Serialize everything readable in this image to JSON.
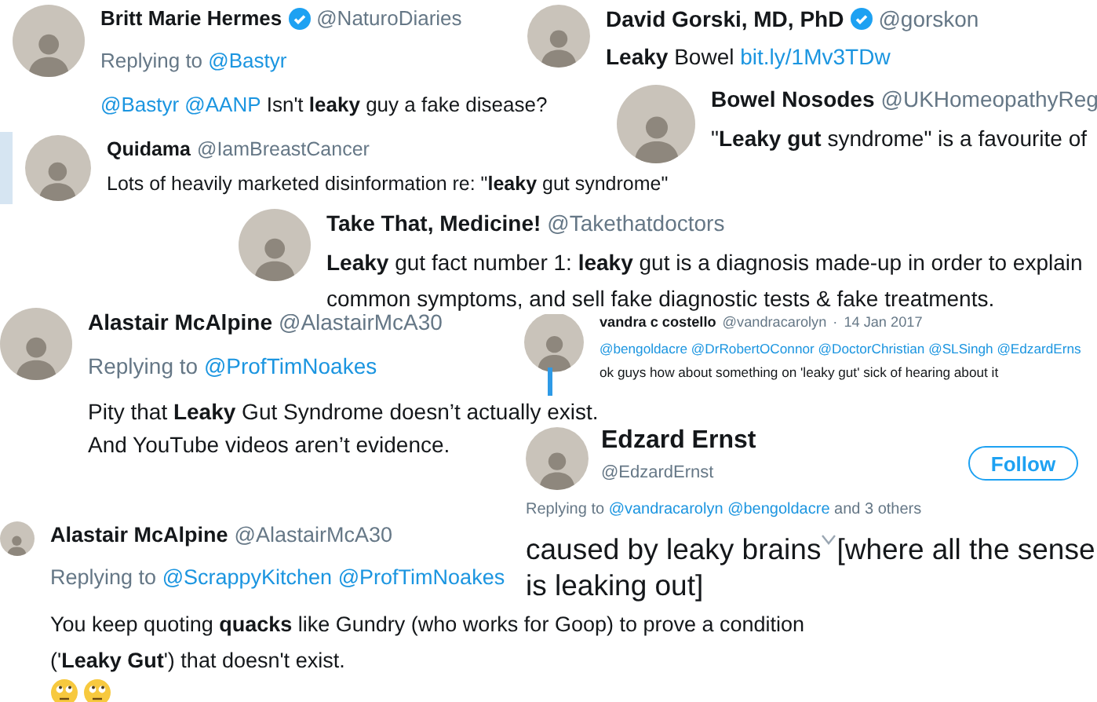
{
  "tweets": [
    {
      "kind": "standard",
      "highlighted": false,
      "name": "Britt Marie Hermes",
      "verified": true,
      "handle": "@NaturoDiaries",
      "replying_to": {
        "label": "Replying to",
        "mentions": [
          "@Bastyr"
        ]
      },
      "lines": [
        [
          {
            "kind": "mention",
            "text": "@Bastyr @AANP"
          },
          {
            "kind": "plain",
            "text": " Isn't **leaky** guy a fake disease?"
          }
        ]
      ]
    },
    {
      "kind": "standard",
      "highlighted": false,
      "name": "David Gorski, MD, PhD",
      "verified": true,
      "handle": "@gorskon",
      "lines": [
        [
          {
            "kind": "plain",
            "text": "**Leaky** Bowel "
          },
          {
            "kind": "link",
            "text": "bit.ly/1Mv3TDw"
          }
        ]
      ]
    },
    {
      "kind": "standard",
      "highlighted": false,
      "name": "Bowel Nosodes",
      "verified": false,
      "handle": "@UKHomeopathyReg",
      "lines": [
        [
          {
            "kind": "plain",
            "text": "\"**Leaky gut** syndrome\" is a favourite of"
          }
        ]
      ]
    },
    {
      "kind": "standard",
      "highlighted": true,
      "name": "Quidama",
      "verified": false,
      "handle": "@IamBreastCancer",
      "lines": [
        [
          {
            "kind": "plain",
            "text": "Lots of heavily marketed disinformation re: \"**leaky** gut syndrome\""
          }
        ]
      ]
    },
    {
      "kind": "standard",
      "highlighted": false,
      "name": "Take That, Medicine!",
      "verified": false,
      "handle": "@Takethatdoctors",
      "lines": [
        [
          {
            "kind": "plain",
            "text": "**Leaky** gut fact number 1: **leaky** gut is a diagnosis made-up in order to explain"
          }
        ],
        [
          {
            "kind": "plain",
            "text": "common symptoms, and sell fake diagnostic tests & fake treatments."
          }
        ]
      ]
    },
    {
      "kind": "standard",
      "highlighted": false,
      "name": "Alastair McAlpine",
      "verified": false,
      "handle": "@AlastairMcA30",
      "replying_to": {
        "label": "Replying to",
        "mentions": [
          "@ProfTimNoakes"
        ]
      },
      "lines": [
        [
          {
            "kind": "plain",
            "text": "Pity that **Leaky** Gut Syndrome doesn’t actually exist."
          }
        ],
        [
          {
            "kind": "plain",
            "text": "And YouTube videos aren’t evidence."
          }
        ]
      ]
    },
    {
      "kind": "compact",
      "highlighted": false,
      "name": "vandra c costello",
      "verified": false,
      "handle": "@vandracarolyn",
      "separator": "·",
      "date": "14 Jan 2017",
      "lines": [
        [
          {
            "kind": "mention",
            "text": "@bengoldacre @DrRobertOConnor @DoctorChristian @SLSingh @EdzardErns"
          }
        ],
        [
          {
            "kind": "plain",
            "text": "ok guys how about something on 'leaky gut' sick of hearing about it"
          }
        ]
      ]
    },
    {
      "kind": "profile",
      "highlighted": false,
      "name": "Edzard Ernst",
      "verified": false,
      "handle": "@EdzardErnst",
      "follow": "Follow",
      "replying_to": {
        "label": "Replying to",
        "mentions": [
          "@vandracarolyn",
          "@bengoldacre"
        ],
        "suffix": "and 3 others"
      },
      "lines": [
        [
          {
            "kind": "plain",
            "text": "caused by leaky brains"
          },
          {
            "kind": "caret"
          },
          {
            "kind": "plain",
            "text": "[where all the sense"
          }
        ],
        [
          {
            "kind": "plain",
            "text": "is leaking out]"
          }
        ]
      ]
    },
    {
      "kind": "standard",
      "highlighted": false,
      "name": "Alastair McAlpine",
      "verified": false,
      "handle": "@AlastairMcA30",
      "replying_to": {
        "label": "Replying to",
        "mentions": [
          "@ScrappyKitchen",
          "@ProfTimNoakes"
        ]
      },
      "lines": [
        [
          {
            "kind": "plain",
            "text": "You keep quoting **quacks** like Gundry (who works for Goop) to prove a condition"
          }
        ],
        [
          {
            "kind": "plain",
            "text": "('**Leaky Gut**') that doesn't exist."
          }
        ],
        [
          {
            "kind": "emoji"
          },
          {
            "kind": "emoji"
          }
        ]
      ]
    }
  ]
}
